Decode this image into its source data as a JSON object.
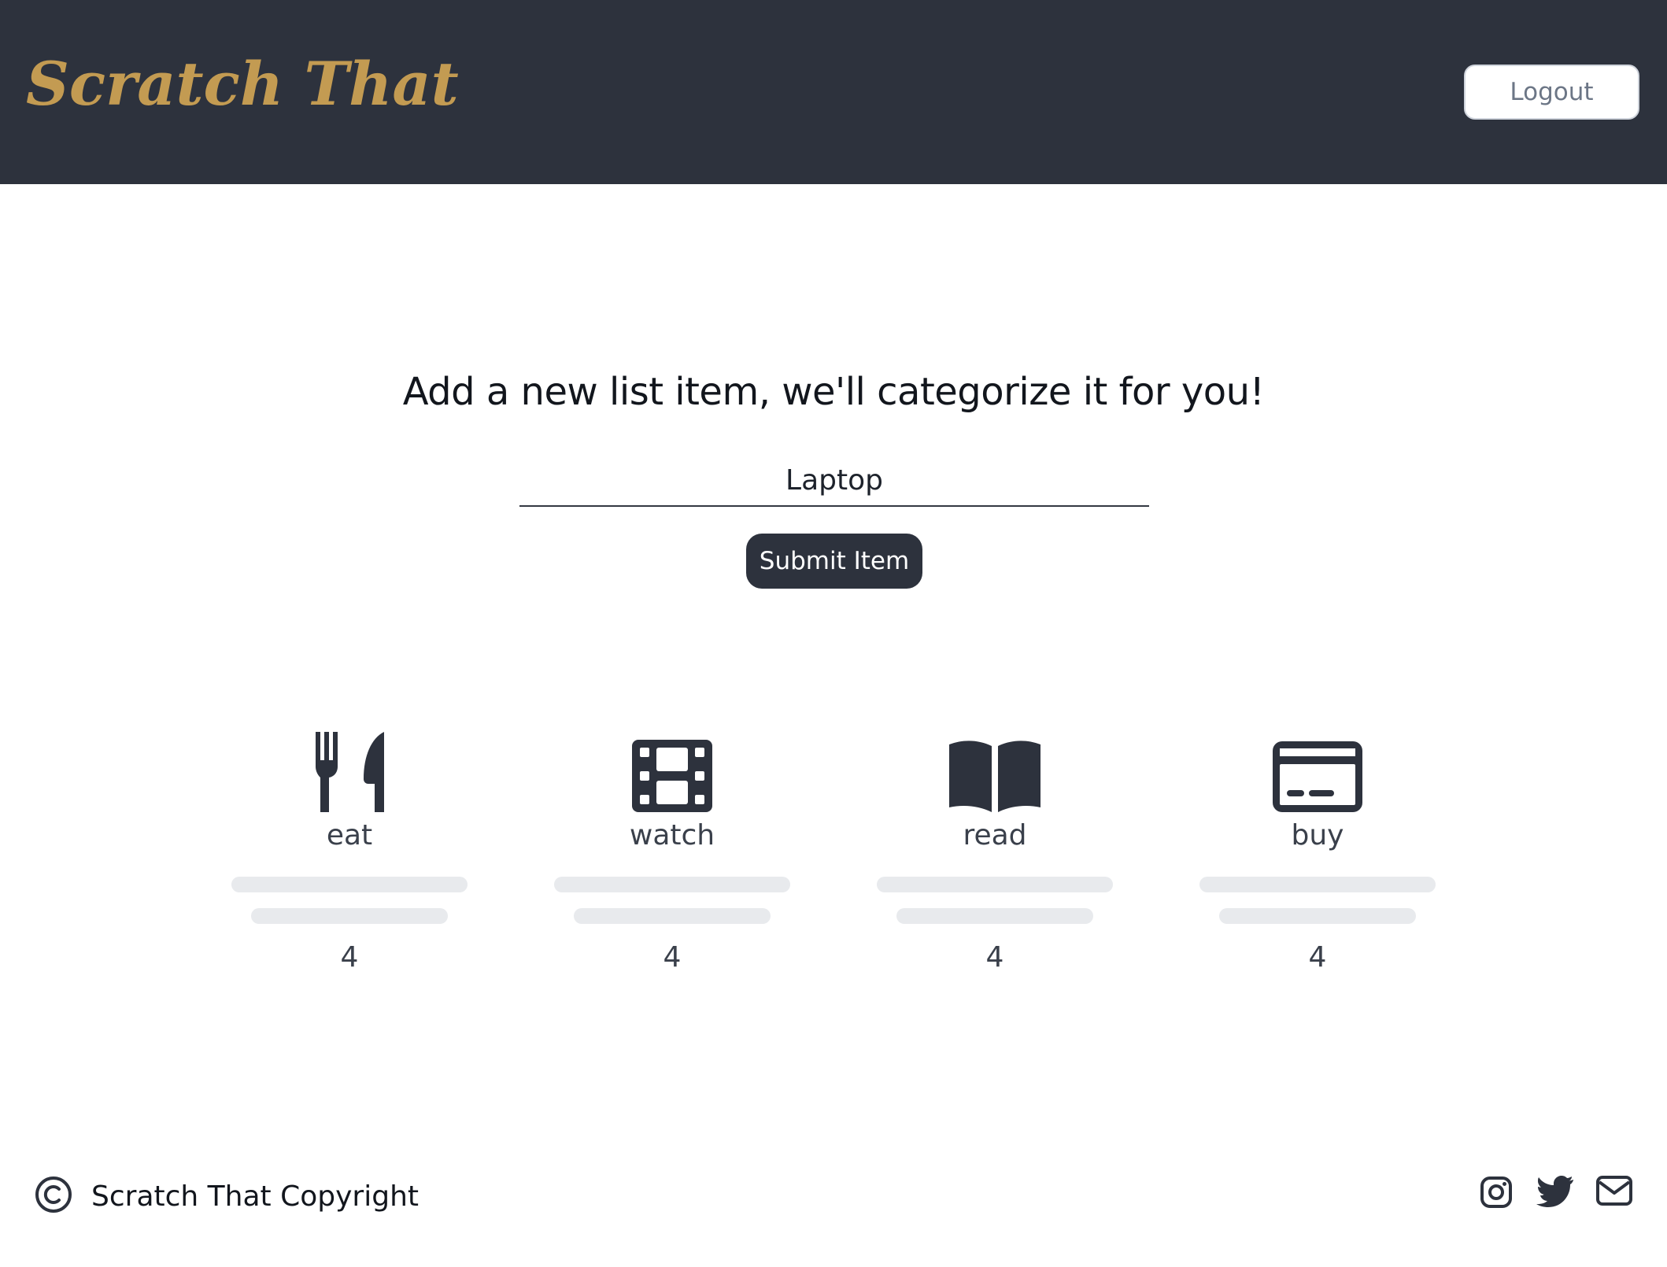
{
  "header": {
    "brand": "Scratch That",
    "logout_label": "Logout"
  },
  "main": {
    "headline": "Add a new list item, we'll categorize it for you!",
    "item_input_value": "Laptop",
    "submit_label": "Submit Item"
  },
  "categories": [
    {
      "label": "eat",
      "icon": "utensils-icon",
      "count": "4"
    },
    {
      "label": "watch",
      "icon": "film-icon",
      "count": "4"
    },
    {
      "label": "read",
      "icon": "book-open-icon",
      "count": "4"
    },
    {
      "label": "buy",
      "icon": "credit-card-icon",
      "count": "4"
    }
  ],
  "footer": {
    "copyright": "Scratch That Copyright",
    "social_icons": [
      "instagram-icon",
      "twitter-icon",
      "envelope-icon"
    ]
  },
  "colors": {
    "header_bg": "#2d323d",
    "brand": "#c39b52",
    "button_bg": "#2d323d",
    "placeholder_bar": "#e8eaed"
  }
}
